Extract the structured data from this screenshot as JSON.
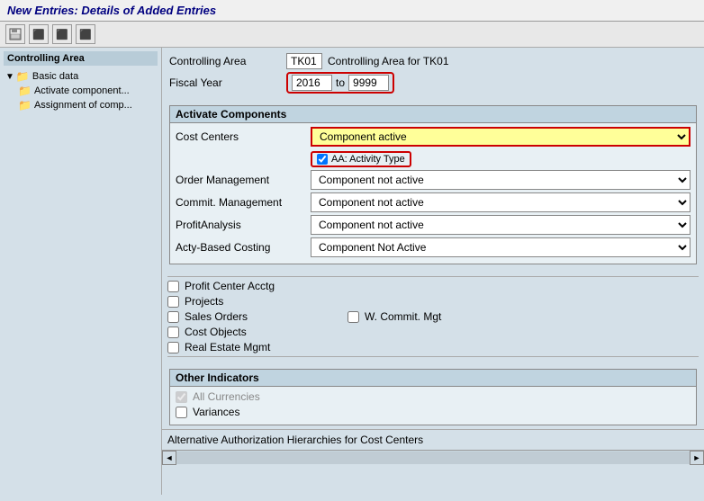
{
  "title": "New Entries: Details of Added Entries",
  "toolbar": {
    "buttons": [
      "save",
      "back",
      "forward",
      "other"
    ]
  },
  "sidebar": {
    "title": "Controlling Area",
    "items": [
      {
        "label": "Basic data",
        "level": 0,
        "hasArrow": true,
        "isFolder": true
      },
      {
        "label": "Activate component...",
        "level": 1,
        "hasArrow": false,
        "isFolder": true
      },
      {
        "label": "Assignment of comp...",
        "level": 1,
        "hasArrow": false,
        "isFolder": true
      }
    ]
  },
  "info": {
    "controlling_area_label": "Controlling Area",
    "controlling_area_code": "TK01",
    "controlling_area_name": "Controlling Area for TK01",
    "fiscal_year_label": "Fiscal Year",
    "fiscal_year_from": "2016",
    "fiscal_year_to_label": "to",
    "fiscal_year_to": "9999"
  },
  "activate_components": {
    "section_title": "Activate Components",
    "rows": [
      {
        "label": "Cost Centers",
        "value": "Component active",
        "highlighted": true
      },
      {
        "label": "Order Management",
        "value": "Component not active",
        "highlighted": false
      },
      {
        "label": "Commit. Management",
        "value": "Component not active",
        "highlighted": false
      },
      {
        "label": "ProfitAnalysis",
        "value": "Component not active",
        "highlighted": false
      },
      {
        "label": "Acty-Based Costing",
        "value": "Component Not Active",
        "highlighted": false
      }
    ],
    "activity_type_label": "AA: Activity Type",
    "activity_type_checked": true
  },
  "checkboxes": {
    "items": [
      {
        "label": "Profit Center Acctg",
        "checked": false
      },
      {
        "label": "Projects",
        "checked": false
      },
      {
        "label": "Sales Orders",
        "checked": false
      },
      {
        "label": "Cost Objects",
        "checked": false
      },
      {
        "label": "Real Estate Mgmt",
        "checked": false
      }
    ],
    "w_commit_mgt_label": "W. Commit. Mgt",
    "w_commit_mgt_checked": false
  },
  "other_indicators": {
    "section_title": "Other Indicators",
    "all_currencies_label": "All Currencies",
    "all_currencies_checked": true,
    "all_currencies_disabled": true,
    "variances_label": "Variances",
    "variances_checked": false
  },
  "alt_auth": {
    "label": "Alternative Authorization Hierarchies for Cost Centers"
  },
  "dropdown_options": [
    "Component active",
    "Component not active",
    "Component Not Active"
  ]
}
